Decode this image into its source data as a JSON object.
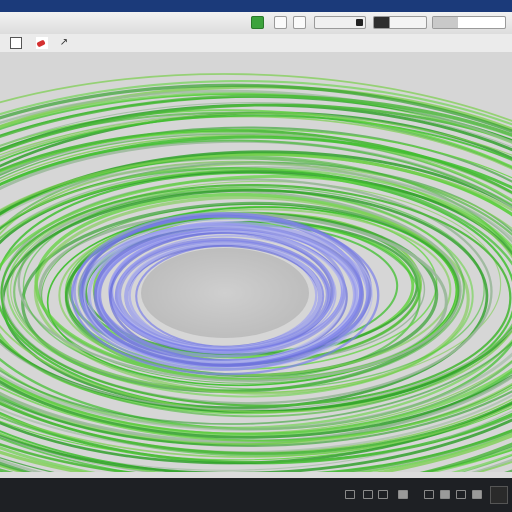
{
  "window": {
    "title": ""
  },
  "toolbar": {
    "document_title": "",
    "green_button_icon": "image-icon",
    "progress_fill_fraction": 0.35
  },
  "secondary_toolbar": {
    "path_text": "",
    "icons": [
      "page-icon",
      "brush-icon",
      "arrow-icon"
    ]
  },
  "viewport": {
    "status_text": "",
    "colors": {
      "background": "#d6d6d6",
      "outer_rings": "#3fbf2e",
      "inner_rings": "#7a7fe8",
      "center_hole": "#c8c8c8"
    }
  },
  "taskbar": {
    "tray_icons": [
      "volume-icon",
      "network-icon",
      "tray-icon-1",
      "tray-icon-2",
      "tray-icon-3",
      "tray-icon-4",
      "tray-icon-5",
      "tray-icon-6"
    ],
    "colors": {
      "background": "#1e2024"
    }
  }
}
